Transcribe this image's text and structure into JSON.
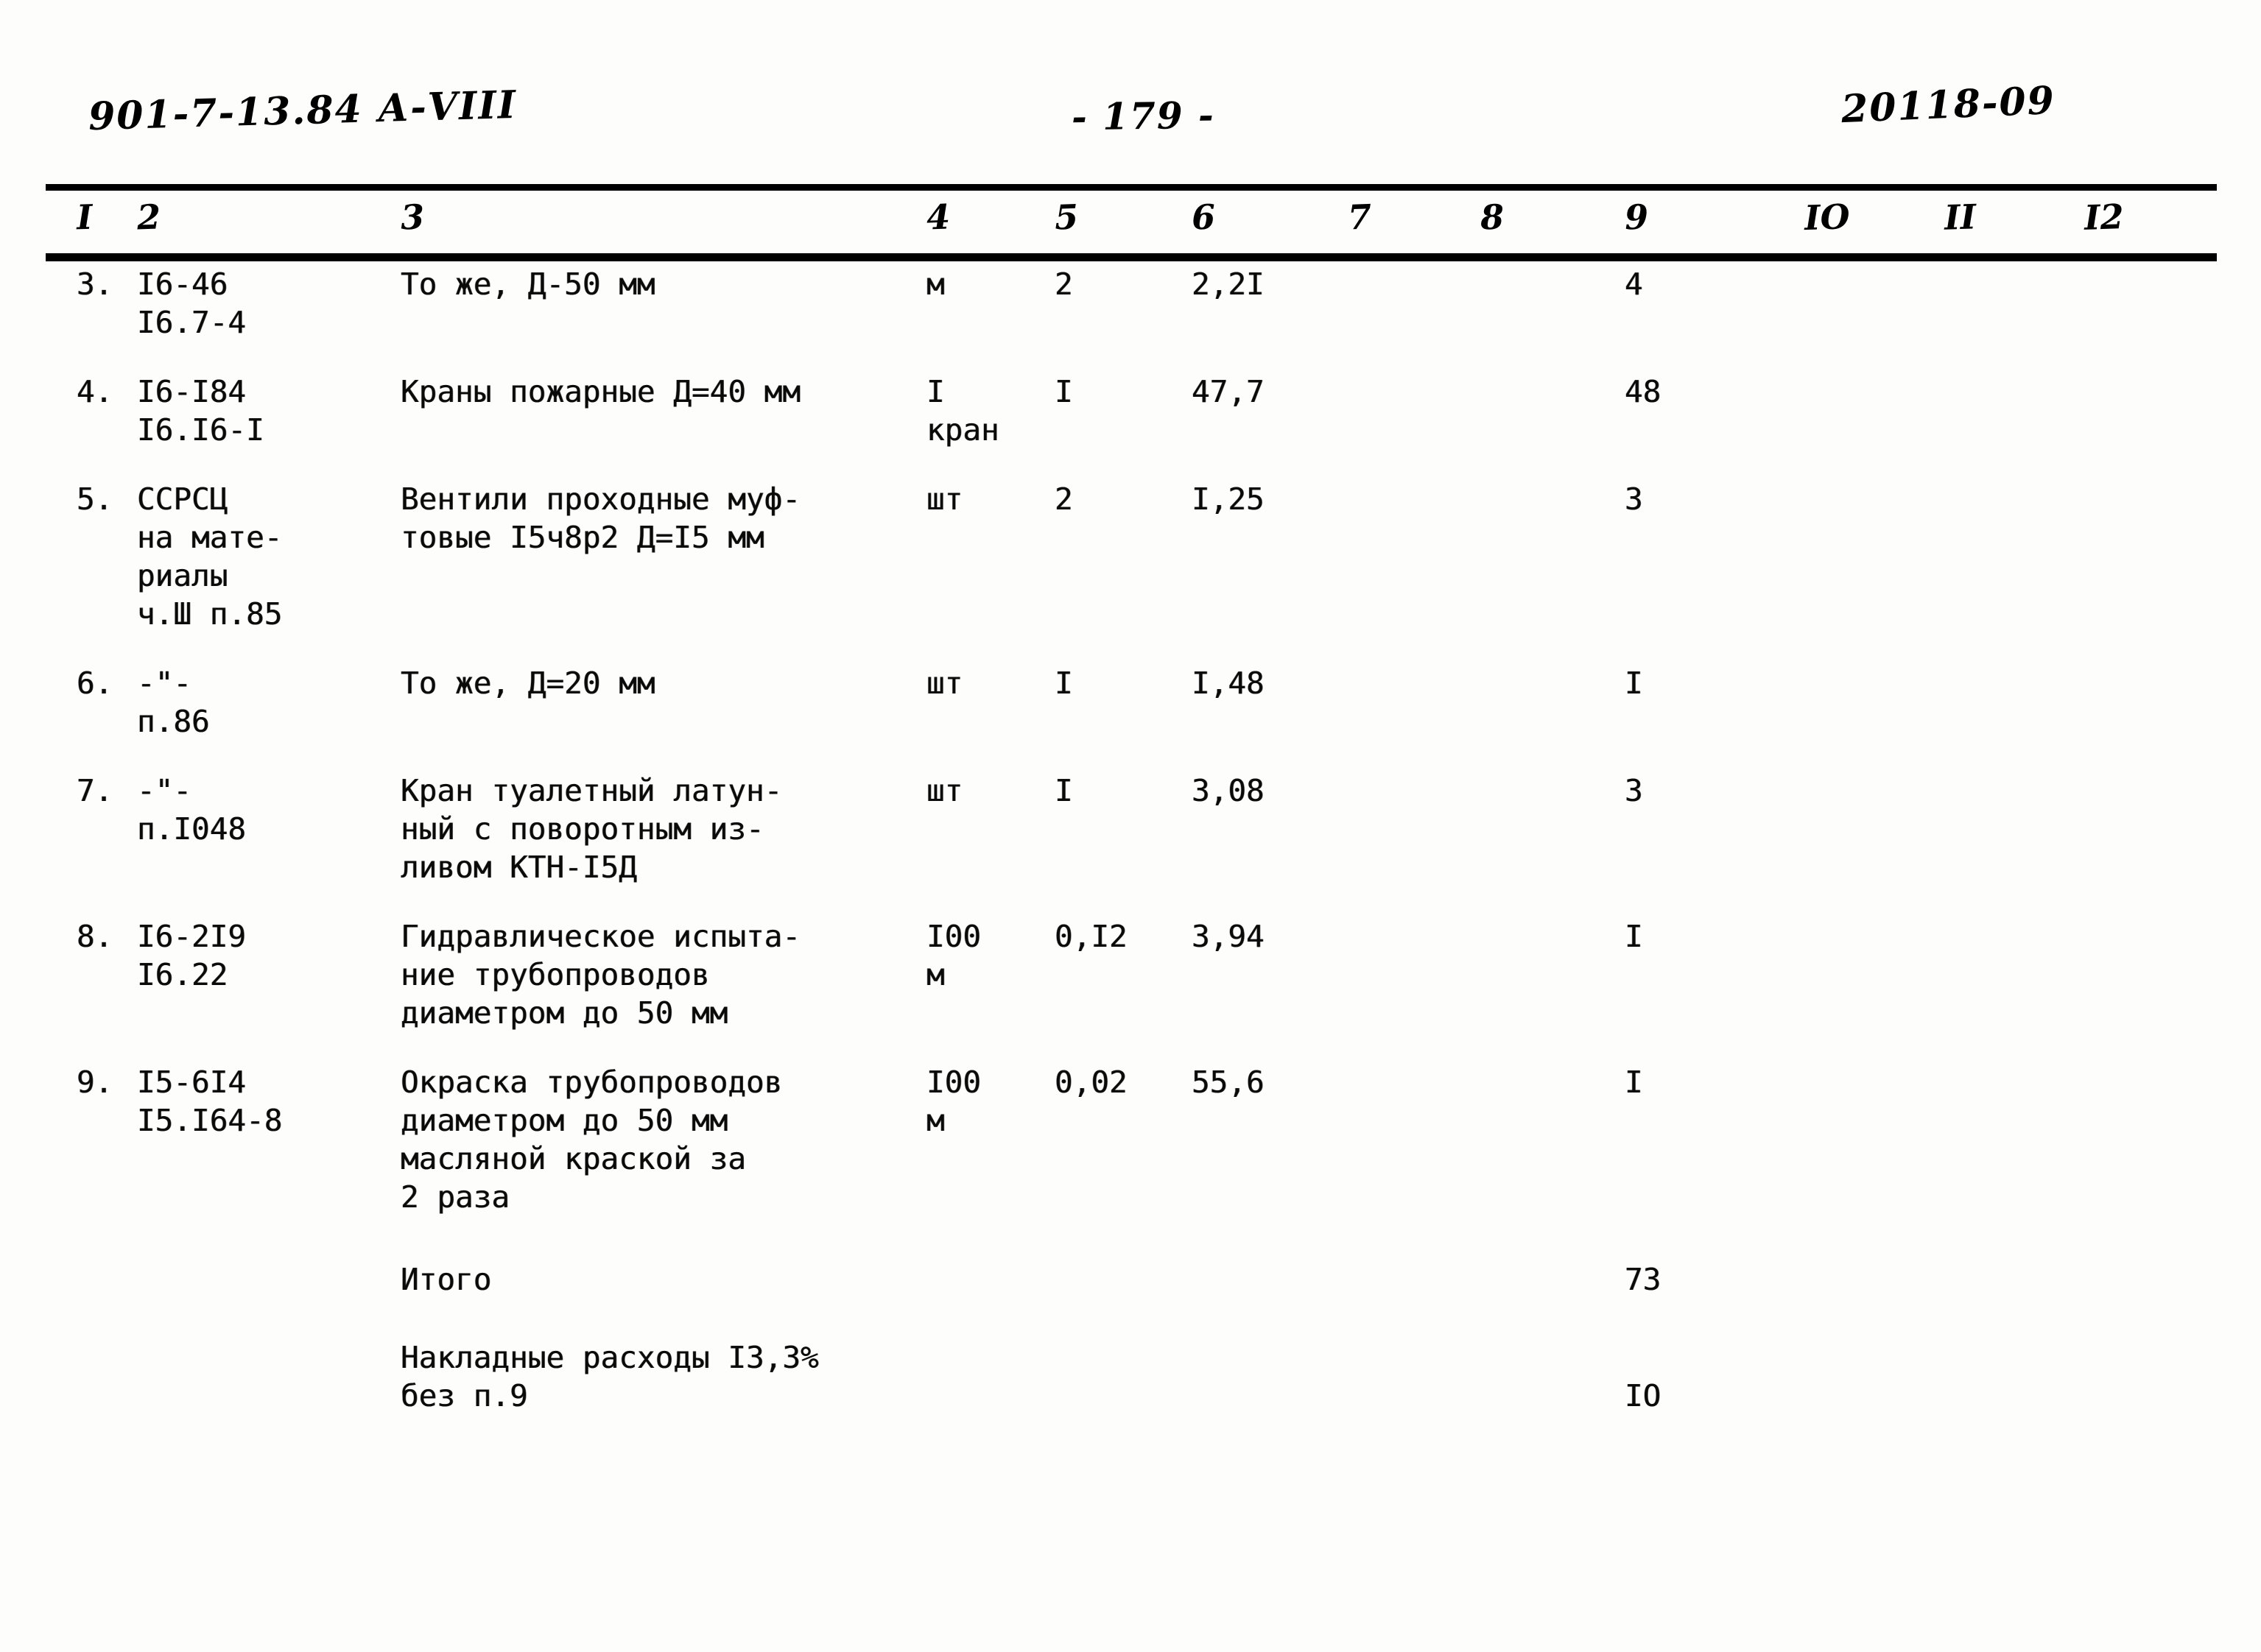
{
  "header": {
    "doc_code": "901-7-13.84 А-VIII",
    "page_number": "- 179 -",
    "sheet_code": "20118-09"
  },
  "table": {
    "column_numbers": [
      "I",
      "2",
      "3",
      "4",
      "5",
      "6",
      "7",
      "8",
      "9",
      "IO",
      "II",
      "I2"
    ],
    "rows": [
      {
        "num": "3.",
        "code": "I6-46\nI6.7-4",
        "description": "То же, Д-50 мм",
        "unit": "м",
        "qty": "2",
        "value": "2,2I",
        "c7": "",
        "c8": "",
        "c9": "4",
        "c10": "",
        "c11": "",
        "c12": ""
      },
      {
        "num": "4.",
        "code": "I6-I84\nI6.I6-I",
        "description": "Краны пожарные Д=40 мм",
        "unit": "I\nкран",
        "qty": "I",
        "value": "47,7",
        "c7": "",
        "c8": "",
        "c9": "48",
        "c10": "",
        "c11": "",
        "c12": ""
      },
      {
        "num": "5.",
        "code": "ССРСЦ\nна мате-\nриалы\nч.Ш п.85",
        "description": "Вентили проходные муф-\nтовые I5ч8р2 Д=I5 мм",
        "unit": "шт",
        "qty": "2",
        "value": "I,25",
        "c7": "",
        "c8": "",
        "c9": "3",
        "c10": "",
        "c11": "",
        "c12": ""
      },
      {
        "num": "6.",
        "code": "-\"-\nп.86",
        "description": "То же, Д=20 мм",
        "unit": "шт",
        "qty": "I",
        "value": "I,48",
        "c7": "",
        "c8": "",
        "c9": "I",
        "c10": "",
        "c11": "",
        "c12": ""
      },
      {
        "num": "7.",
        "code": "-\"-\nп.I048",
        "description": "Кран туалетный латун-\nный с поворотным из-\nливом КТН-I5Д",
        "unit": "шт",
        "qty": "I",
        "value": "3,08",
        "c7": "",
        "c8": "",
        "c9": "3",
        "c10": "",
        "c11": "",
        "c12": ""
      },
      {
        "num": "8.",
        "code": "I6-2I9\nI6.22",
        "description": "Гидравлическое испыта-\nние трубопроводов\nдиаметром до 50 мм",
        "unit": "I00\nм",
        "qty": "0,I2",
        "value": "3,94",
        "c7": "",
        "c8": "",
        "c9": "I",
        "c10": "",
        "c11": "",
        "c12": ""
      },
      {
        "num": "9.",
        "code": "I5-6I4\nI5.I64-8",
        "description": "Окраска трубопроводов\nдиаметром до 50 мм\nмасляной краской за\n2 раза",
        "unit": "I00\nм",
        "qty": "0,02",
        "value": "55,6",
        "c7": "",
        "c8": "",
        "c9": "I",
        "c10": "",
        "c11": "",
        "c12": ""
      }
    ],
    "footer_rows": [
      {
        "label": "Итого",
        "value": "73"
      },
      {
        "label": "Накладные расходы I3,3%\nбез п.9",
        "value": "IO"
      }
    ]
  }
}
